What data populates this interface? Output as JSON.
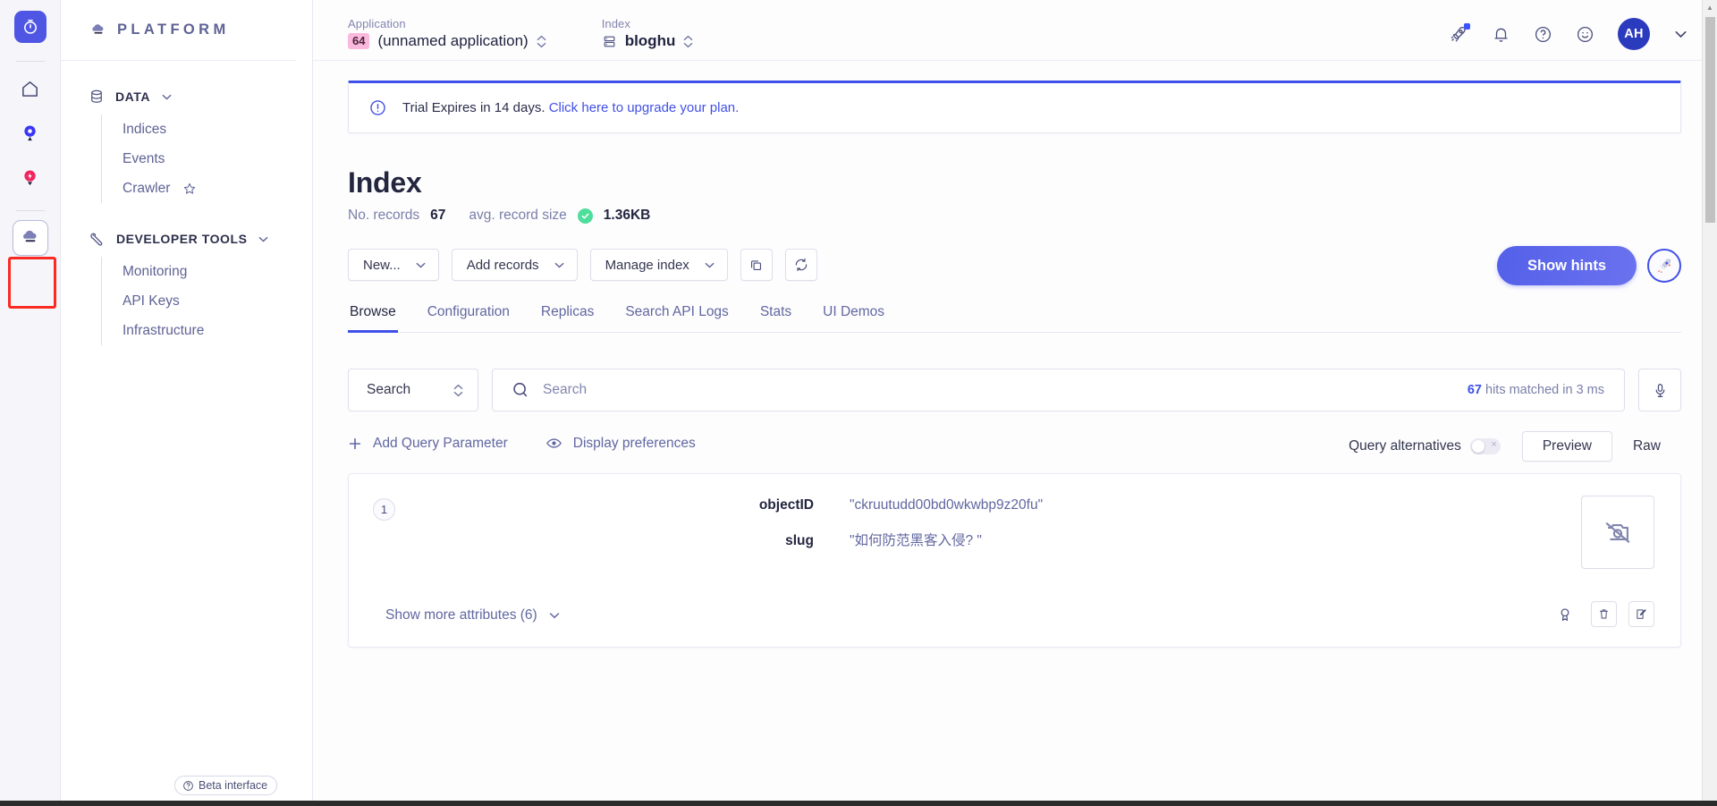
{
  "colors": {
    "accent": "#3f51e8",
    "brand_logo_bg": "#4f56e3",
    "app_badge_bg": "#fbb8dd",
    "avatar_bg": "#2b3bbd",
    "status_ok": "#4ede9b",
    "highlight_box": "#fb2b24",
    "muted_text": "#6167a0"
  },
  "rail": {
    "items": [
      {
        "name": "timer-logo",
        "label": "Timer"
      },
      {
        "name": "home",
        "label": "Home"
      },
      {
        "name": "search-pin",
        "label": "Search"
      },
      {
        "name": "lightning-pin",
        "label": "Events"
      },
      {
        "name": "cloud-platform",
        "label": "Platform",
        "selected": true
      }
    ]
  },
  "sidebar": {
    "brand": "PLATFORM",
    "close_label": "×",
    "sections": [
      {
        "label": "DATA",
        "icon": "database-icon",
        "items": [
          {
            "label": "Indices",
            "starred": false
          },
          {
            "label": "Events",
            "starred": false
          },
          {
            "label": "Crawler",
            "starred": true
          }
        ]
      },
      {
        "label": "DEVELOPER TOOLS",
        "icon": "wrench-icon",
        "items": [
          {
            "label": "Monitoring",
            "starred": false
          },
          {
            "label": "API Keys",
            "starred": false
          },
          {
            "label": "Infrastructure",
            "starred": false
          }
        ]
      }
    ],
    "beta_badge": "Beta interface"
  },
  "topbar": {
    "application": {
      "label": "Application",
      "badge": "64",
      "value": "(unnamed application)"
    },
    "index": {
      "label": "Index",
      "value": "bloghu"
    },
    "icons": [
      {
        "name": "rocket-icon",
        "badge": true
      },
      {
        "name": "bell-icon",
        "badge": false
      },
      {
        "name": "help-circle-icon",
        "badge": false
      },
      {
        "name": "smiley-icon",
        "badge": false
      }
    ],
    "avatar_initials": "AH",
    "account_chevron": "⌄"
  },
  "banner": {
    "icon": "alert-circle-icon",
    "text": "Trial Expires in 14 days.",
    "link": "Click here to upgrade your plan."
  },
  "page": {
    "title": "Index",
    "stats": {
      "records_label": "No. records",
      "records_value": "67",
      "size_label": "avg. record size",
      "size_value": "1.36KB"
    }
  },
  "toolbar": {
    "buttons": [
      {
        "label": "New...",
        "chevron": true
      },
      {
        "label": "Add records",
        "chevron": true
      },
      {
        "label": "Manage index",
        "chevron": true
      }
    ],
    "copy_icon": "copy-icon",
    "refresh_icon": "refresh-icon",
    "hints_label": "Show hints",
    "hints_rocket_icon": "rocket-icon"
  },
  "tabs": [
    {
      "label": "Browse",
      "active": true
    },
    {
      "label": "Configuration",
      "active": false
    },
    {
      "label": "Replicas",
      "active": false
    },
    {
      "label": "Search API Logs",
      "active": false
    },
    {
      "label": "Stats",
      "active": false
    },
    {
      "label": "UI Demos",
      "active": false
    }
  ],
  "search": {
    "kind_value": "Search",
    "placeholder": "Search",
    "value": "",
    "hits_count": "67",
    "hits_suffix": "hits matched in 3 ms",
    "mic_icon": "microphone-icon"
  },
  "filters": {
    "add_query_parameter": "Add Query Parameter",
    "display_preferences": "Display preferences",
    "query_alternatives_label": "Query alternatives",
    "query_alternatives_on": false,
    "view_modes": [
      {
        "label": "Preview",
        "active": true
      },
      {
        "label": "Raw",
        "active": false
      }
    ]
  },
  "records": [
    {
      "number": "1",
      "attributes": [
        {
          "key": "objectID",
          "value": "\"ckruutudd00bd0wkwbp9z20fu\""
        },
        {
          "key": "slug",
          "value": "\"如何防范黑客入侵? \""
        }
      ],
      "show_more_label": "Show more attributes (6)",
      "image_placeholder_icon": "camera-off-icon",
      "actions": [
        {
          "name": "ribbon-icon"
        },
        {
          "name": "trash-icon"
        },
        {
          "name": "edit-icon"
        }
      ]
    }
  ]
}
